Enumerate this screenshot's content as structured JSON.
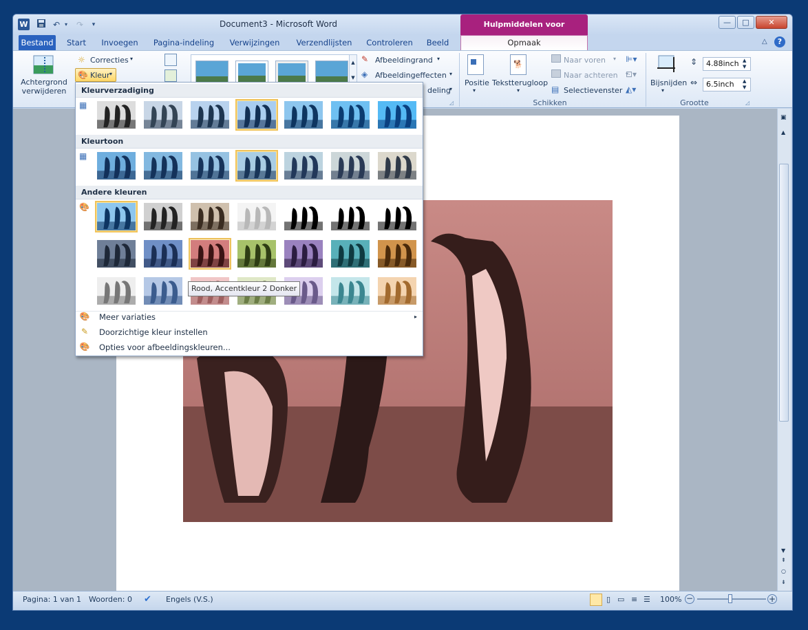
{
  "window": {
    "doc_title": "Document3  -  Microsoft Word",
    "context_tab_title": "Hulpmiddelen voor afbeeldingen",
    "min_symbol": "—",
    "max_symbol": "□",
    "close_symbol": "✕"
  },
  "tabs": [
    "Bestand",
    "Start",
    "Invoegen",
    "Pagina-indeling",
    "Verwijzingen",
    "Verzendlijsten",
    "Controleren",
    "Beeld"
  ],
  "context_tab": "Opmaak",
  "ribbon": {
    "remove_bg": [
      "Achtergrond",
      "verwijderen"
    ],
    "corrections": "Correcties",
    "color": "Kleur",
    "border": "Afbeeldingrand",
    "effects": "Afbeeldingeffecten",
    "layout_partial": "deling",
    "position": "Positie",
    "wrap_text": "Tekstterugloop",
    "bring_forward": "Naar voren",
    "send_backward": "Naar achteren",
    "selection_pane": "Selectievenster",
    "arrange_group": "Schikken",
    "crop": "Bijsnijden",
    "height": "4.88inch",
    "width": "6.5inch",
    "size_group": "Grootte"
  },
  "dropdown": {
    "saturation_header": "Kleurverzadiging",
    "tone_header": "Kleurtoon",
    "recolor_header": "Andere kleuren",
    "more_variations": "Meer variaties",
    "set_transparent": "Doorzichtige kleur instellen",
    "color_options": "Opties voor afbeeldingskleuren...",
    "saturation_swatches": [
      {
        "tint": "#222222",
        "sky": "#dddddd"
      },
      {
        "tint": "#334455",
        "sky": "#c8d6e6"
      },
      {
        "tint": "#1d3550",
        "sky": "#b8d2ee"
      },
      {
        "tint": "#123055",
        "sky": "#a9cdf0"
      },
      {
        "tint": "#0e3560",
        "sky": "#8dc6ee"
      },
      {
        "tint": "#0b3c70",
        "sky": "#6fc0f2"
      },
      {
        "tint": "#0a4080",
        "sky": "#55baf5"
      }
    ],
    "tone_swatches": [
      {
        "tint": "#12305a",
        "sky": "#6faede"
      },
      {
        "tint": "#14325a",
        "sky": "#82b8e0"
      },
      {
        "tint": "#17345a",
        "sky": "#96c2e2"
      },
      {
        "tint": "#183558",
        "sky": "#a9cde4"
      },
      {
        "tint": "#22385a",
        "sky": "#bcd3df"
      },
      {
        "tint": "#2a3a55",
        "sky": "#ccd6d8"
      },
      {
        "tint": "#303a48",
        "sky": "#dcd8cc"
      }
    ],
    "recolor_swatches": [
      {
        "tint": "#0d3562",
        "sky": "#8dc6ee"
      },
      {
        "tint": "#222222",
        "sky": "#d0d0d0"
      },
      {
        "tint": "#3a2c20",
        "sky": "#cfc0ad"
      },
      {
        "tint": "#b8b8b8",
        "sky": "#f4f4f4"
      },
      {
        "tint": "#000000",
        "sky": "#ffffff"
      },
      {
        "tint": "#000000",
        "sky": "#ffffff"
      },
      {
        "tint": "#000000",
        "sky": "#ffffff"
      },
      {
        "tint": "#1e2838",
        "sky": "#6f7f98"
      },
      {
        "tint": "#1b2f55",
        "sky": "#6f8fc6"
      },
      {
        "tint": "#3a1414",
        "sky": "#d37d7d"
      },
      {
        "tint": "#2e3d14",
        "sky": "#a7c26a"
      },
      {
        "tint": "#2b1d40",
        "sky": "#9a82bf"
      },
      {
        "tint": "#0f3a40",
        "sky": "#58b0b9"
      },
      {
        "tint": "#4a2a0a",
        "sky": "#d1944c"
      },
      {
        "tint": "#777777",
        "sky": "#eeeeee"
      },
      {
        "tint": "#3b5c8e",
        "sky": "#b5c8e6"
      },
      {
        "tint": "#9e5f5f",
        "sky": "#f0c6c6"
      },
      {
        "tint": "#6b7d46",
        "sky": "#dfe8c6"
      },
      {
        "tint": "#6a5a8a",
        "sky": "#dccfee"
      },
      {
        "tint": "#3b8690",
        "sky": "#c4e6ea"
      },
      {
        "tint": "#a26a2e",
        "sky": "#f4d4b0"
      }
    ]
  },
  "tooltip": "Rood, Accentkleur 2 Donker",
  "status": {
    "page": "Pagina: 1 van 1",
    "words": "Woorden: 0",
    "language": "Engels (V.S.)",
    "zoom": "100%"
  },
  "colors": {
    "file_tab": "#2a62bf",
    "context_tab": "#a8217e",
    "image_tint": "#b87b78"
  }
}
